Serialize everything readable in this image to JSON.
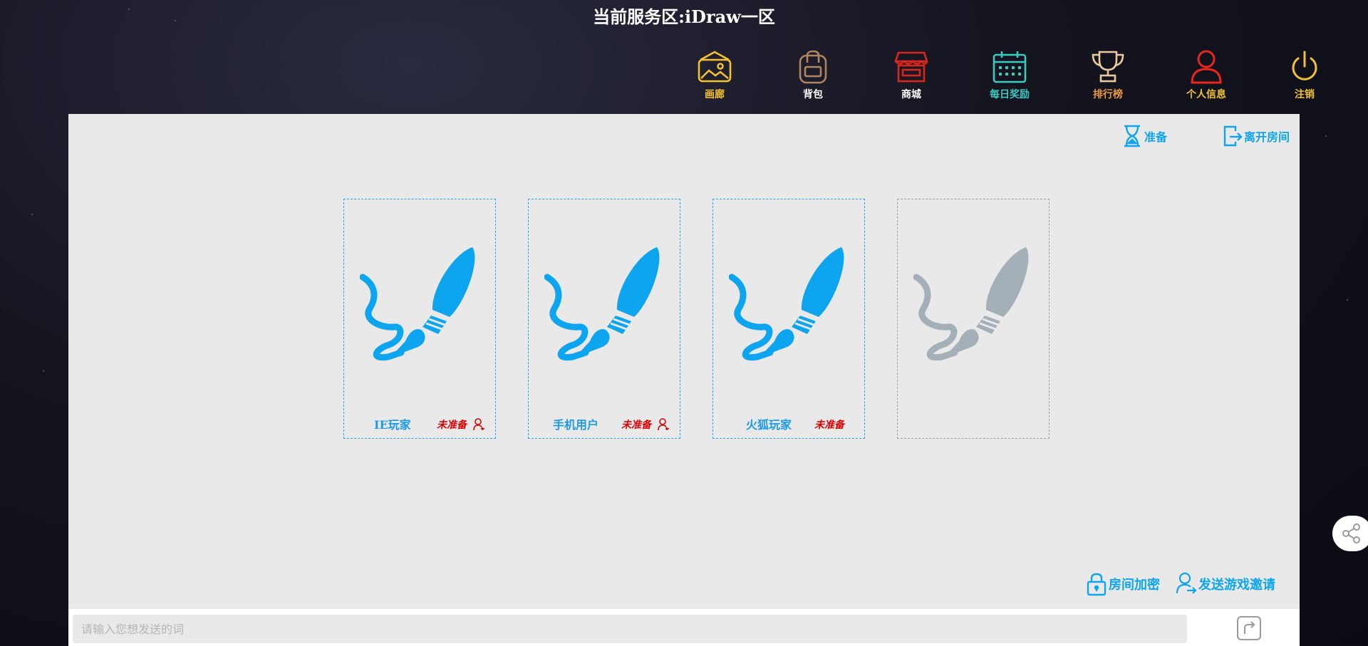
{
  "header": {
    "title": "当前服务区:iDraw一区"
  },
  "nav": [
    {
      "label": "画廊",
      "icon": "gallery-icon",
      "color": "#f2c230"
    },
    {
      "label": "背包",
      "icon": "backpack-icon",
      "color": "#b08560"
    },
    {
      "label": "商城",
      "icon": "store-icon",
      "color": "#d8261c"
    },
    {
      "label": "每日奖励",
      "icon": "calendar-icon",
      "color": "#3cc9c0"
    },
    {
      "label": "排行榜",
      "icon": "trophy-icon",
      "color": "#e8c9a0"
    },
    {
      "label": "个人信息",
      "icon": "user-icon",
      "color": "#e8261c"
    },
    {
      "label": "注销",
      "icon": "power-icon",
      "color": "#f2c230"
    }
  ],
  "room": {
    "ready_label": "准备",
    "leave_label": "离开房间",
    "lock_label": "房间加密",
    "invite_label": "发送游戏邀请",
    "accent": "#0ea5f0"
  },
  "seats": [
    {
      "name": "IE玩家",
      "status": "未准备",
      "occupied": true,
      "add_friend": true
    },
    {
      "name": "手机用户",
      "status": "未准备",
      "occupied": true,
      "add_friend": true
    },
    {
      "name": "火狐玩家",
      "status": "未准备",
      "occupied": true,
      "add_friend": false
    },
    {
      "name": "",
      "status": "",
      "occupied": false,
      "add_friend": false
    }
  ],
  "chat": {
    "placeholder": "请输入您想发送的词",
    "value": ""
  }
}
